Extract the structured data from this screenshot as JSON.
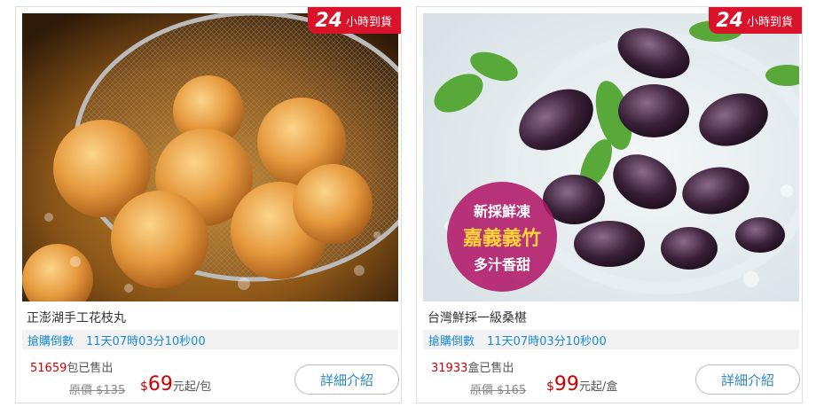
{
  "products": [
    {
      "badge_num": "24",
      "badge_text": "小時到貨",
      "title": "正澎湖手工花枝丸",
      "countdown_label": "搶購倒數",
      "countdown_time": "11天07時03分10秒00",
      "sold_count": "51659",
      "sold_suffix": "包已售出",
      "orig_price": "原價 $135",
      "price_currency": "$",
      "price_amount": "69",
      "price_suffix": "元起/包",
      "button": "詳細介紹"
    },
    {
      "badge_num": "24",
      "badge_text": "小時到貨",
      "title": "台灣鮮採一級桑椹",
      "countdown_label": "搶購倒數",
      "countdown_time": "11天07時03分10秒00",
      "sold_count": "31933",
      "sold_suffix": "盒已售出",
      "orig_price": "原價 $165",
      "price_currency": "$",
      "price_amount": "99",
      "price_suffix": "元起/盒",
      "button": "詳細介紹",
      "overlay": {
        "line1": "新採鮮凍",
        "line2": "嘉義義竹",
        "line3": "多汁香甜"
      }
    }
  ]
}
